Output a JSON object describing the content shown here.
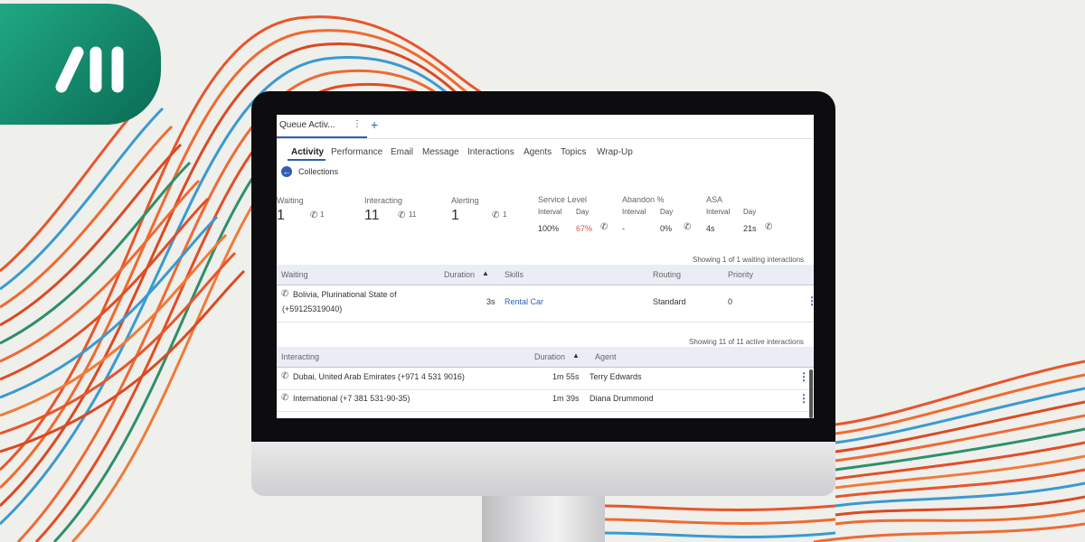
{
  "tab": {
    "title": "Queue Activ...",
    "menu": "⋮",
    "add": "+"
  },
  "nav": {
    "items": [
      "Activity",
      "Performance",
      "Email",
      "Message",
      "Interactions",
      "Agents",
      "Topics",
      "Wrap-Up"
    ]
  },
  "breadcrumb": {
    "back": "←",
    "label": "Collections"
  },
  "stats": {
    "waiting": {
      "label": "Waiting",
      "value": "1",
      "phone_count": "1"
    },
    "interacting": {
      "label": "Interacting",
      "value": "11",
      "phone_count": "11"
    },
    "alerting": {
      "label": "Alerting",
      "value": "1",
      "phone_count": "1"
    },
    "service_level": {
      "label": "Service Level",
      "interval_label": "Interval",
      "day_label": "Day",
      "interval": "100%",
      "day": "67%"
    },
    "abandon": {
      "label": "Abandon %",
      "interval_label": "Interval",
      "day_label": "Day",
      "interval": "-",
      "day": "0%"
    },
    "asa": {
      "label": "ASA",
      "interval_label": "Interval",
      "day_label": "Day",
      "interval": "4s",
      "day": "21s"
    }
  },
  "waiting_table": {
    "showing": "Showing 1 of 1 waiting interactions",
    "headers": {
      "waiting": "Waiting",
      "duration": "Duration",
      "skills": "Skills",
      "routing": "Routing",
      "priority": "Priority"
    },
    "rows": [
      {
        "line1": "Bolivia, Plurinational State of",
        "line2": "(+59125319040)",
        "duration": "3s",
        "skills": "Rental Car",
        "routing": "Standard",
        "priority": "0"
      }
    ]
  },
  "interacting_table": {
    "showing": "Showing 11 of 11 active interactions",
    "headers": {
      "interacting": "Interacting",
      "duration": "Duration",
      "agent": "Agent"
    },
    "rows": [
      {
        "name": "Dubai, United Arab Emirates (+971 4 531 9016)",
        "duration": "1m 55s",
        "agent": "Terry Edwards"
      },
      {
        "name": "International (+7 381 531-90-35)",
        "duration": "1m 39s",
        "agent": "Diana Drummond"
      }
    ]
  },
  "colors": {
    "accent": "#2e5fb5",
    "alert": "#d9534f",
    "brand": "#1fa884"
  }
}
